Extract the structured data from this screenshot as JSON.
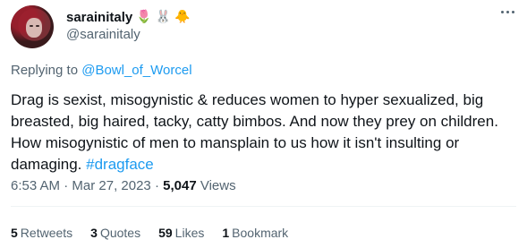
{
  "author": {
    "display_name": "sarainitaly",
    "emojis": [
      "🌷",
      "🐰",
      "🐥"
    ],
    "handle": "@sarainitaly"
  },
  "reply": {
    "prefix": "Replying to ",
    "target": "@Bowl_of_Worcel"
  },
  "tweet": {
    "text": "Drag is sexist, misogynistic & reduces women to hyper sexualized, big breasted, big haired, tacky, catty bimbos. And now they prey on children. How misogynistic of men to mansplain to us how it isn't insulting or damaging. ",
    "hashtag": "#dragface"
  },
  "meta": {
    "time": "6:53 AM",
    "sep1": " · ",
    "date": "Mar 27, 2023",
    "sep2": " · ",
    "views_count": "5,047",
    "views_label": " Views"
  },
  "stats": [
    {
      "count": "5",
      "label": "Retweets"
    },
    {
      "count": "3",
      "label": "Quotes"
    },
    {
      "count": "59",
      "label": "Likes"
    },
    {
      "count": "1",
      "label": "Bookmark"
    }
  ],
  "colors": {
    "link": "#1d9bf0",
    "secondary": "#536471",
    "primary": "#0f1419"
  }
}
